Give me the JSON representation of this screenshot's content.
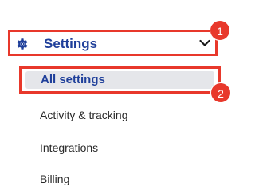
{
  "nav": {
    "section_label": "Settings",
    "section_icon": "gear-icon",
    "expand_icon": "chevron-down-icon",
    "items": [
      {
        "label": "All settings",
        "selected": true
      },
      {
        "label": "Activity & tracking",
        "selected": false
      },
      {
        "label": "Integrations",
        "selected": false
      },
      {
        "label": "Billing",
        "selected": false
      }
    ]
  },
  "annotations": {
    "badge_1": "1",
    "badge_2": "2"
  },
  "colors": {
    "accent_text": "#1f3f9a",
    "highlight_border": "#e8382b",
    "selected_bg": "#e5e6ea",
    "badge_fill": "#e8382b"
  }
}
